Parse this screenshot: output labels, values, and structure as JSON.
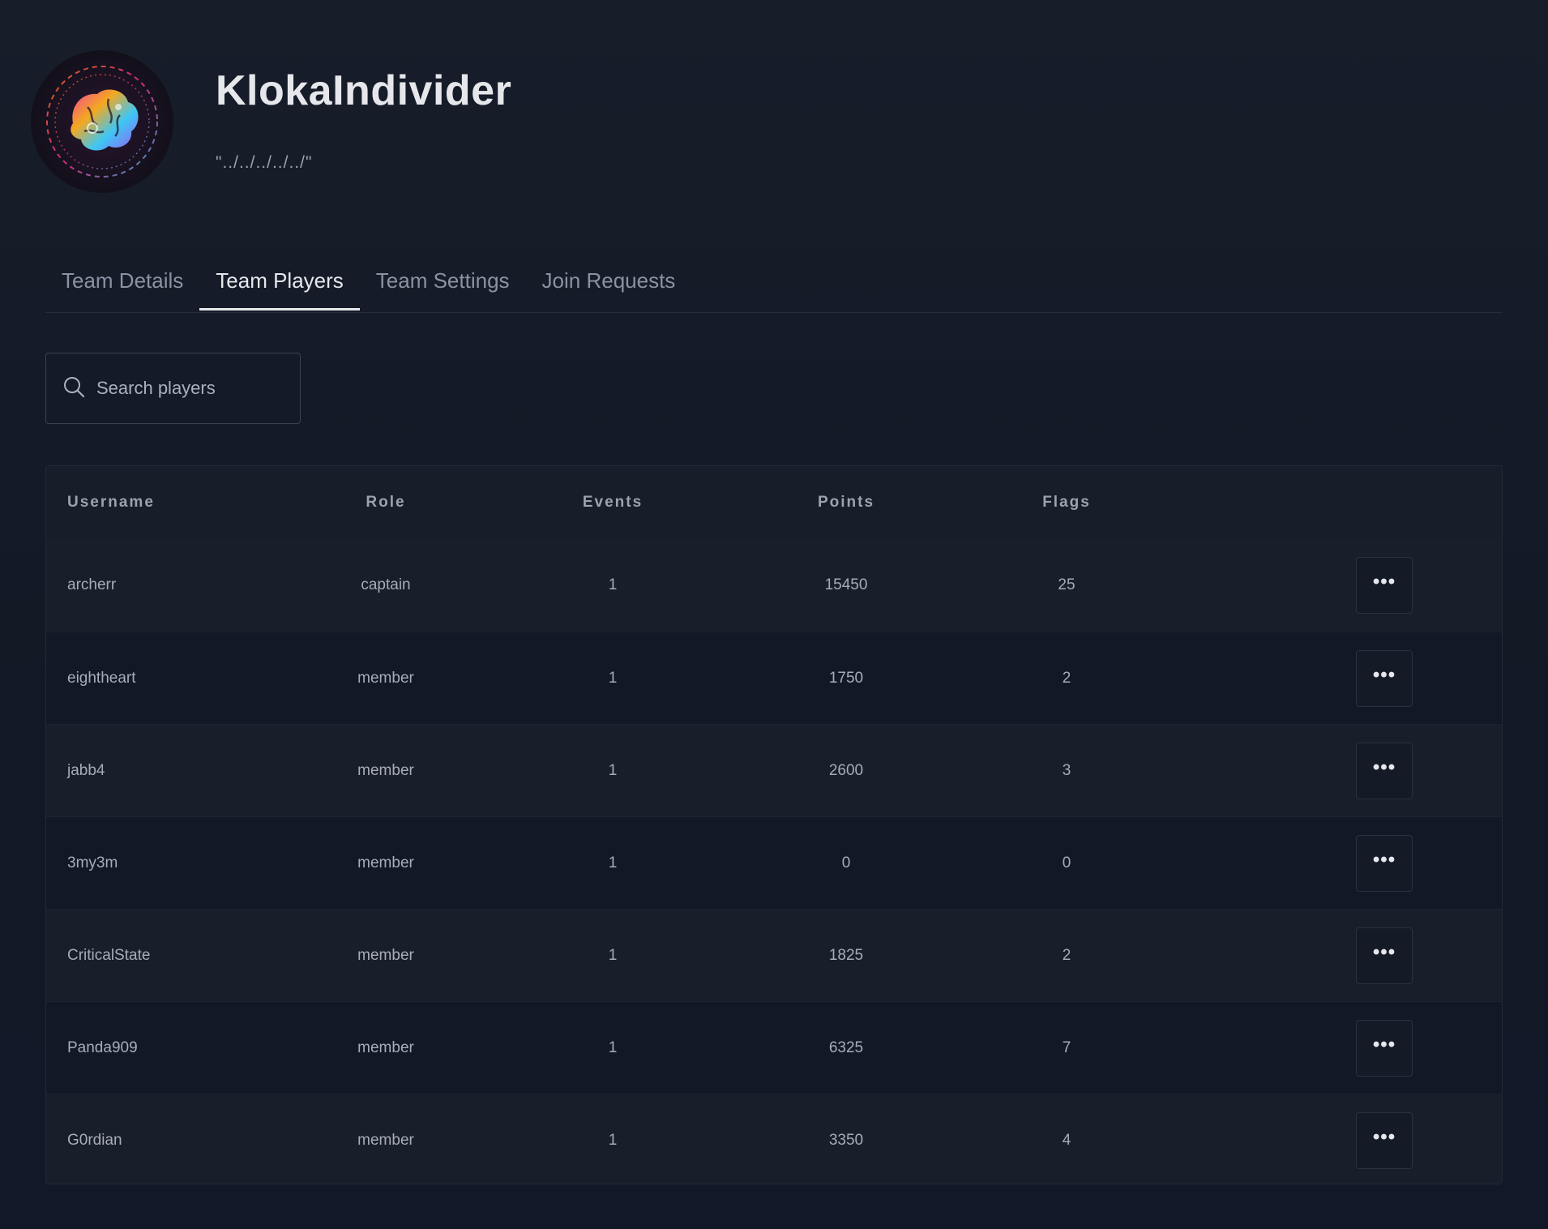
{
  "team": {
    "name": "KlokaIndivider",
    "motto": "\"../../../../../\""
  },
  "tabs": [
    {
      "label": "Team Details",
      "active": false
    },
    {
      "label": "Team Players",
      "active": true
    },
    {
      "label": "Team Settings",
      "active": false
    },
    {
      "label": "Join Requests",
      "active": false
    }
  ],
  "search": {
    "placeholder": "Search players",
    "value": ""
  },
  "table": {
    "columns": [
      "Username",
      "Role",
      "Events",
      "Points",
      "Flags"
    ],
    "rows": [
      {
        "username": "archerr",
        "role": "captain",
        "events": "1",
        "points": "15450",
        "flags": "25"
      },
      {
        "username": "eightheart",
        "role": "member",
        "events": "1",
        "points": "1750",
        "flags": "2"
      },
      {
        "username": "jabb4",
        "role": "member",
        "events": "1",
        "points": "2600",
        "flags": "3"
      },
      {
        "username": "3my3m",
        "role": "member",
        "events": "1",
        "points": "0",
        "flags": "0"
      },
      {
        "username": "CriticalState",
        "role": "member",
        "events": "1",
        "points": "1825",
        "flags": "2"
      },
      {
        "username": "Panda909",
        "role": "member",
        "events": "1",
        "points": "6325",
        "flags": "7"
      },
      {
        "username": "G0rdian",
        "role": "member",
        "events": "1",
        "points": "3350",
        "flags": "4"
      }
    ],
    "actions_icon": "more-horizontal-icon"
  },
  "colors": {
    "background": "#121926",
    "text_primary": "#e5e7eb",
    "text_muted": "#a7adb8",
    "border": "#2a3140"
  }
}
